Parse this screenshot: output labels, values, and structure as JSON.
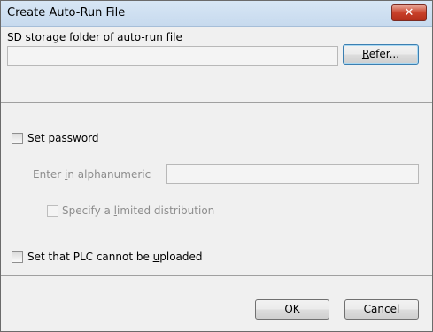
{
  "dialog": {
    "title": "Create Auto-Run File",
    "close_icon": "close-x-icon",
    "close_glyph": "✕"
  },
  "folder_section": {
    "label": "SD storage folder of auto-run file",
    "path_value": "",
    "refer_button": {
      "pre": "",
      "key": "R",
      "post": "efer..."
    }
  },
  "password_section": {
    "set_password": {
      "pre": "Set ",
      "key": "p",
      "post": "assword",
      "checked": false
    },
    "alphanumeric": {
      "pre": "Enter ",
      "key": "i",
      "post": "n alphanumeric",
      "value": "",
      "enabled": false
    },
    "limited_distribution": {
      "pre": "Specify a ",
      "key": "l",
      "post": "imited distribution",
      "checked": false,
      "enabled": false
    },
    "no_upload": {
      "pre": "Set that PLC cannot be ",
      "key": "u",
      "post": "ploaded",
      "checked": false
    }
  },
  "footer": {
    "ok_label": "OK",
    "cancel_label": "Cancel"
  }
}
